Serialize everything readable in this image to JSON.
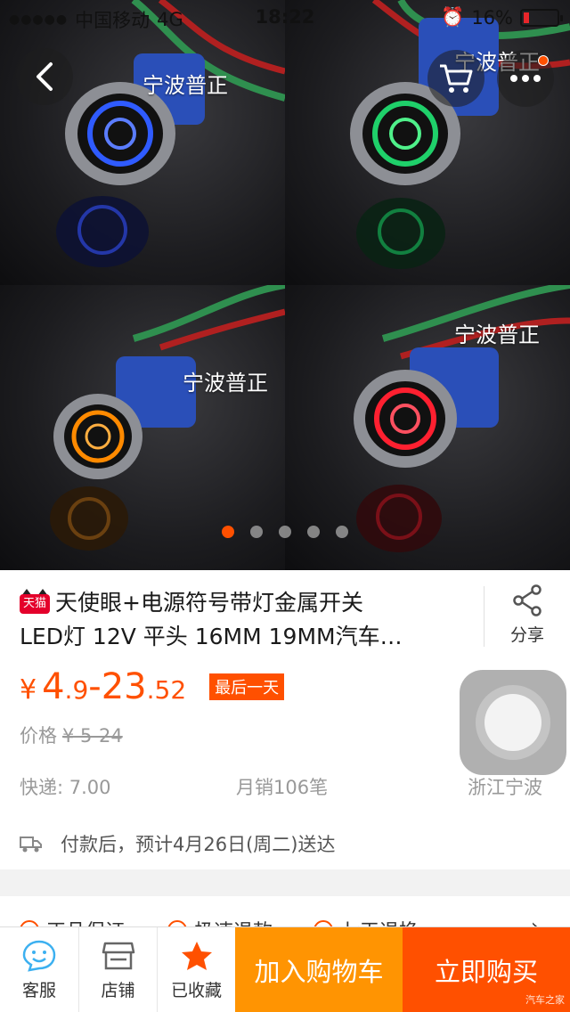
{
  "status_bar": {
    "signal_dots": "●●●●●",
    "carrier": "中国移动",
    "network": "4G",
    "time": "18:22",
    "battery_percent": "16%",
    "battery_level": 0.16
  },
  "gallery": {
    "watermark": "宁波普正",
    "tiles": [
      {
        "led_color": "#2f5bff"
      },
      {
        "led_color": "#1fd06a"
      },
      {
        "led_color": "#ff8a00"
      },
      {
        "led_color": "#ff2030"
      }
    ],
    "page_count": 5,
    "active_page": 1
  },
  "product": {
    "tmall_badge": "天猫",
    "title_line1": "天使眼+电源符号带灯金属开关",
    "title_line2": "LED灯 12V 平头 16MM 19MM汽车…",
    "share_label": "分享",
    "price_currency": "¥",
    "price_low_int": "4",
    "price_low_dec": ".9",
    "price_sep": "-",
    "price_high_int": "23",
    "price_high_dec": ".52",
    "sale_tag": "最后一天",
    "orig_label": "价格",
    "orig_price": "¥ 5-24",
    "shipping": "快递: 7.00",
    "monthly_sales": "月销106笔",
    "location": "浙江宁波",
    "delivery_text": "付款后，预计4月26日(周二)送达"
  },
  "services": [
    "正品保证",
    "极速退款",
    "七天退换"
  ],
  "bottom_bar": {
    "tab_service": "客服",
    "tab_shop": "店铺",
    "tab_fav": "已收藏",
    "add_to_cart": "加入购物车",
    "buy_now": "立即购买",
    "source_watermark": "汽车之家"
  },
  "colors": {
    "accent": "#ff5000",
    "cart_button": "#ff9402",
    "tmall_red": "#e4002b"
  }
}
